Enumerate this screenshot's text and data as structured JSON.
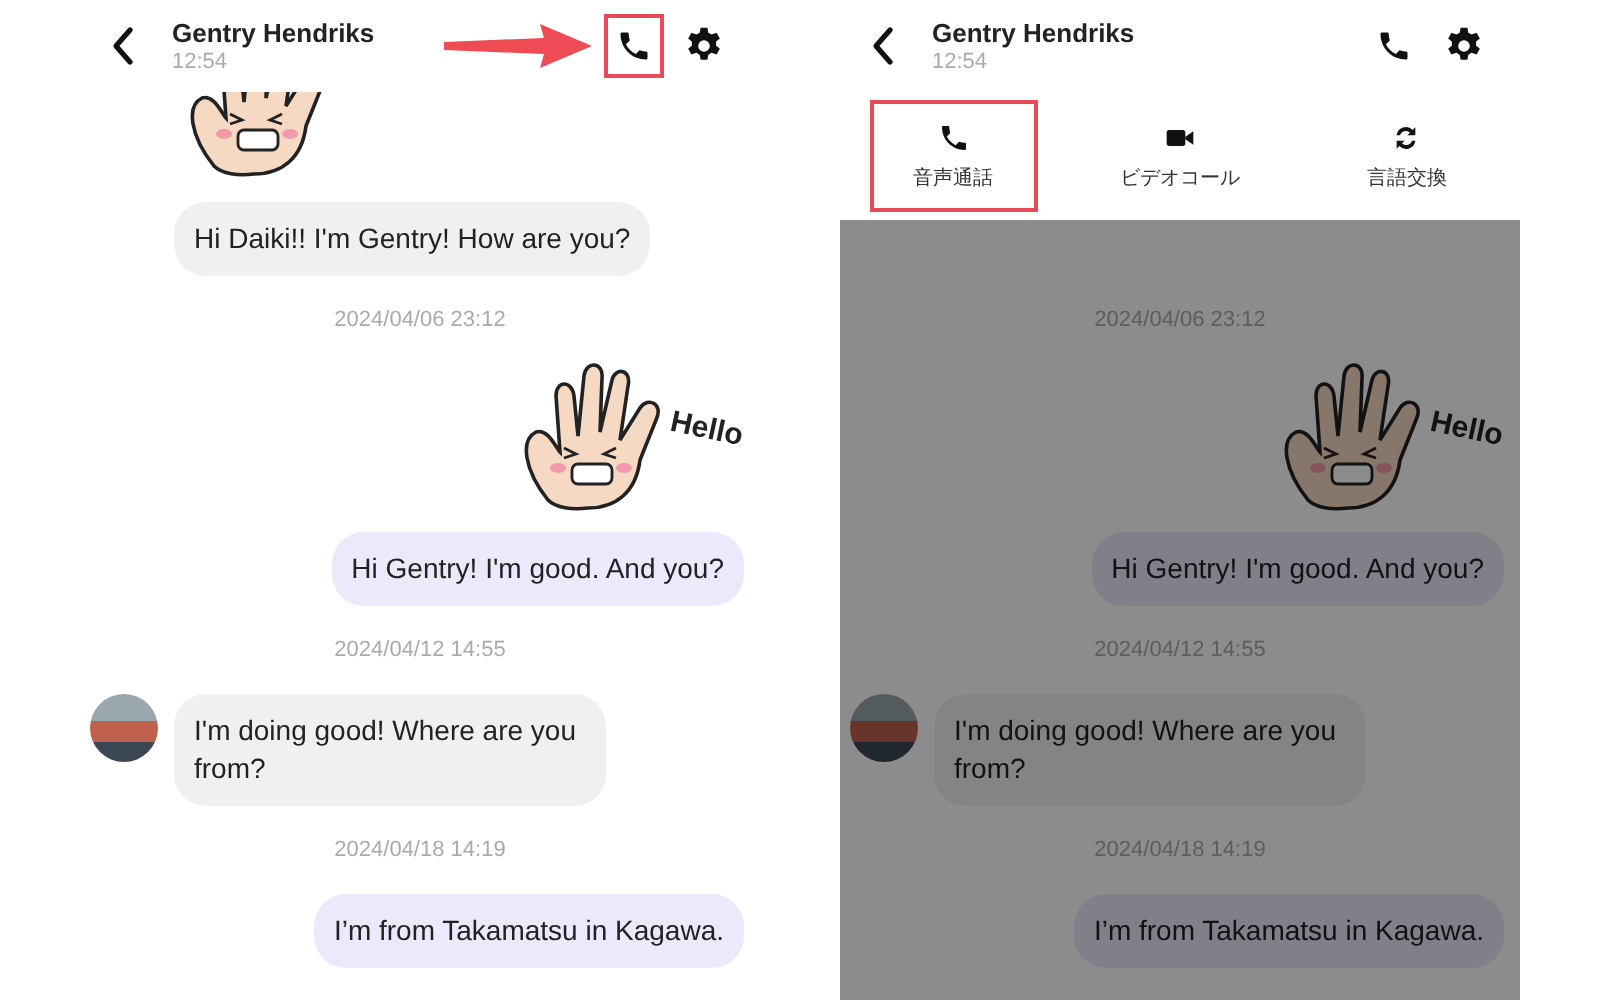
{
  "panels": [
    {
      "header": {
        "name": "Gentry Hendriks",
        "time": "12:54"
      },
      "call_highlighted": true,
      "pointer_arrow": true,
      "messages": [
        {
          "kind": "incoming-sticker-cropped"
        },
        {
          "kind": "incoming",
          "text": "Hi Daiki!! I'm Gentry! How are you?"
        },
        {
          "kind": "timestamp",
          "text": "2024/04/06 23:12"
        },
        {
          "kind": "outgoing-sticker",
          "text": "Hello"
        },
        {
          "kind": "outgoing",
          "text": "Hi Gentry! I'm good. And you?"
        },
        {
          "kind": "timestamp",
          "text": "2024/04/12 14:55"
        },
        {
          "kind": "incoming-avatar",
          "text": "I'm doing good! Where are you from?"
        },
        {
          "kind": "timestamp",
          "text": "2024/04/18 14:19"
        },
        {
          "kind": "outgoing",
          "text": "I’m from Takamatsu in Kagawa."
        }
      ]
    },
    {
      "header": {
        "name": "Gentry Hendriks",
        "time": "12:54"
      },
      "call_highlighted": false,
      "dimmed": true,
      "call_menu": [
        {
          "kind": "voice",
          "label": "音声通話",
          "highlighted": true
        },
        {
          "kind": "video",
          "label": "ビデオコール",
          "highlighted": false
        },
        {
          "kind": "swap",
          "label": "言語交換",
          "highlighted": false
        }
      ],
      "messages": [
        {
          "kind": "timestamp",
          "text": "2024/04/06 23:12"
        },
        {
          "kind": "outgoing-sticker",
          "text": "Hello"
        },
        {
          "kind": "outgoing",
          "text": "Hi Gentry! I'm good. And you?"
        },
        {
          "kind": "timestamp",
          "text": "2024/04/12 14:55"
        },
        {
          "kind": "incoming-avatar",
          "text": "I'm doing good! Where are you from?"
        },
        {
          "kind": "timestamp",
          "text": "2024/04/18 14:19"
        },
        {
          "kind": "outgoing",
          "text": "I’m from Takamatsu in Kagawa."
        }
      ]
    }
  ]
}
